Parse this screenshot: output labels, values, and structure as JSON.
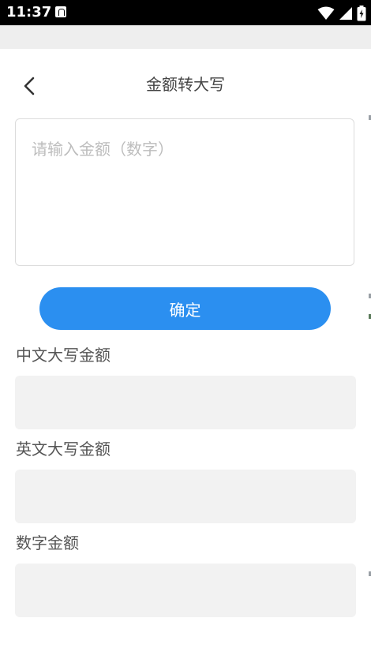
{
  "status_bar": {
    "time": "11:37",
    "icons": [
      "app-notification-icon",
      "wifi-icon",
      "cellular-signal-icon",
      "battery-icon"
    ]
  },
  "header": {
    "title": "金额转大写",
    "back_icon": "chevron-left-icon"
  },
  "input": {
    "value": "",
    "placeholder": "请输入金额（数字）"
  },
  "confirm_button": {
    "label": "确定"
  },
  "results": [
    {
      "label": "中文大写金额",
      "value": ""
    },
    {
      "label": "英文大写金额",
      "value": ""
    },
    {
      "label": "数字金额",
      "value": ""
    }
  ],
  "colors": {
    "accent": "#2b8ff0",
    "result_bg": "#f2f2f2",
    "status_bar": "#000000"
  }
}
